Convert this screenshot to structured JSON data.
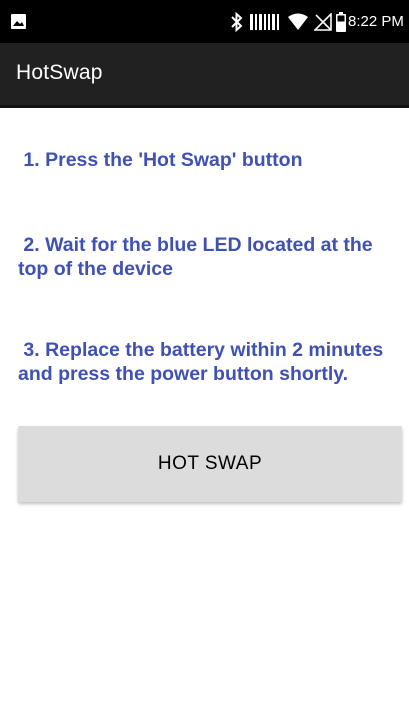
{
  "status_bar": {
    "time": "8:22 PM",
    "icons": [
      "image-icon",
      "bluetooth-icon",
      "signal-bars-icon",
      "wifi-icon",
      "no-sim-icon",
      "battery-icon"
    ]
  },
  "app_bar": {
    "title": "HotSwap"
  },
  "instructions": [
    {
      "text": " 1. Press the 'Hot Swap' button"
    },
    {
      "text": " 2. Wait for the blue LED located at the top of the device"
    },
    {
      "text": " 3. Replace the battery within 2 minutes and press the power button shortly."
    }
  ],
  "hot_swap_button": {
    "label": "HOT SWAP"
  },
  "colors": {
    "instruction_text": "#3f51b5",
    "app_bar_bg": "#212121",
    "status_bar_bg": "#000000",
    "button_bg": "#dcdcdc"
  }
}
